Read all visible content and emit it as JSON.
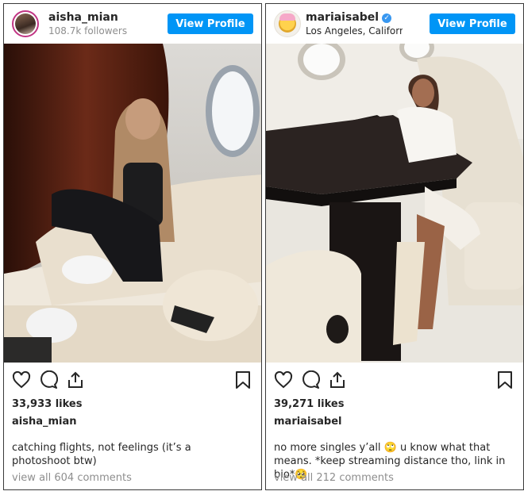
{
  "posts": [
    {
      "username": "aisha_mian",
      "subtitle": "108.7k followers",
      "button": "View Profile",
      "likes": "33,933 likes",
      "caption_user": "aisha_mian",
      "caption": "catching flights, not feelings (it’s a photoshoot btw)",
      "comments": "view all 604 comments"
    },
    {
      "username": "mariaisabel",
      "verified": "✓",
      "subtitle": "Los Angeles, California",
      "button": "View Profile",
      "likes": "39,271 likes",
      "caption_user": "mariaisabel",
      "caption": "no more singles y’all 🙄 u know what that means. *keep streaming distance tho, link in bio*🥺",
      "comments": "view all 212 comments"
    }
  ],
  "icons": [
    "heart-icon",
    "comment-icon",
    "share-icon",
    "bookmark-icon"
  ],
  "colors": {
    "button": "#0095f6",
    "muted": "#8e8e8e",
    "text": "#262626"
  }
}
